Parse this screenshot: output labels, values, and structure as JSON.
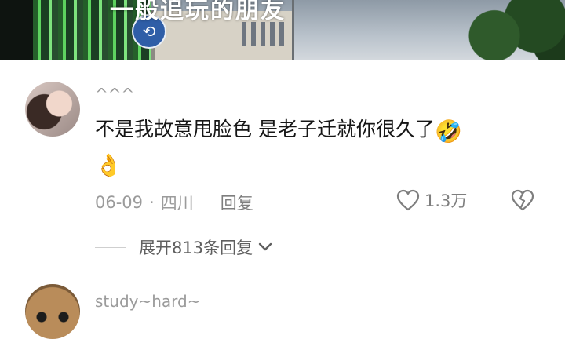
{
  "video": {
    "caption": "一般追玩的朋友"
  },
  "comments": [
    {
      "username": "^^^",
      "text": "不是我故意甩脸色 是老子迁就你很久了",
      "emojis": [
        "rolling-on-floor-laughing",
        "ok-hand"
      ],
      "date": "06-09",
      "location": "四川",
      "reply_label": "回复",
      "like_count": "1.3万",
      "expand_label": "展开813条回复"
    },
    {
      "username": "study~hard~"
    }
  ],
  "colors": {
    "meta_gray": "#9b9b9b",
    "text": "#161616"
  }
}
